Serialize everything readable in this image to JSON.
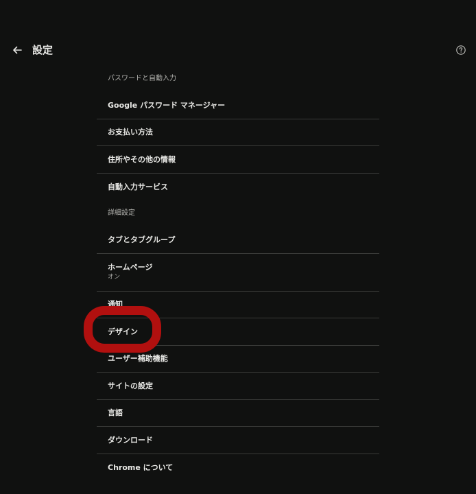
{
  "header": {
    "title": "設定",
    "back_icon": "arrow-left-icon",
    "help_icon": "help-circle-icon"
  },
  "sections": [
    {
      "title": "パスワードと自動入力",
      "items": [
        {
          "label": "Google パスワード マネージャー"
        },
        {
          "label": "お支払い方法"
        },
        {
          "label": "住所やその他の情報"
        },
        {
          "label": "自動入力サービス"
        }
      ]
    },
    {
      "title": "詳細設定",
      "items": [
        {
          "label": "タブとタブグループ"
        },
        {
          "label": "ホームページ",
          "sublabel": "オン"
        },
        {
          "label": "通知"
        },
        {
          "label": "デザイン"
        },
        {
          "label": "ユーザー補助機能"
        },
        {
          "label": "サイトの設定"
        },
        {
          "label": "言語"
        },
        {
          "label": "ダウンロード"
        },
        {
          "label": "Chrome について"
        }
      ]
    }
  ],
  "colors": {
    "background": "#101110",
    "highlight": "#b1100f"
  }
}
